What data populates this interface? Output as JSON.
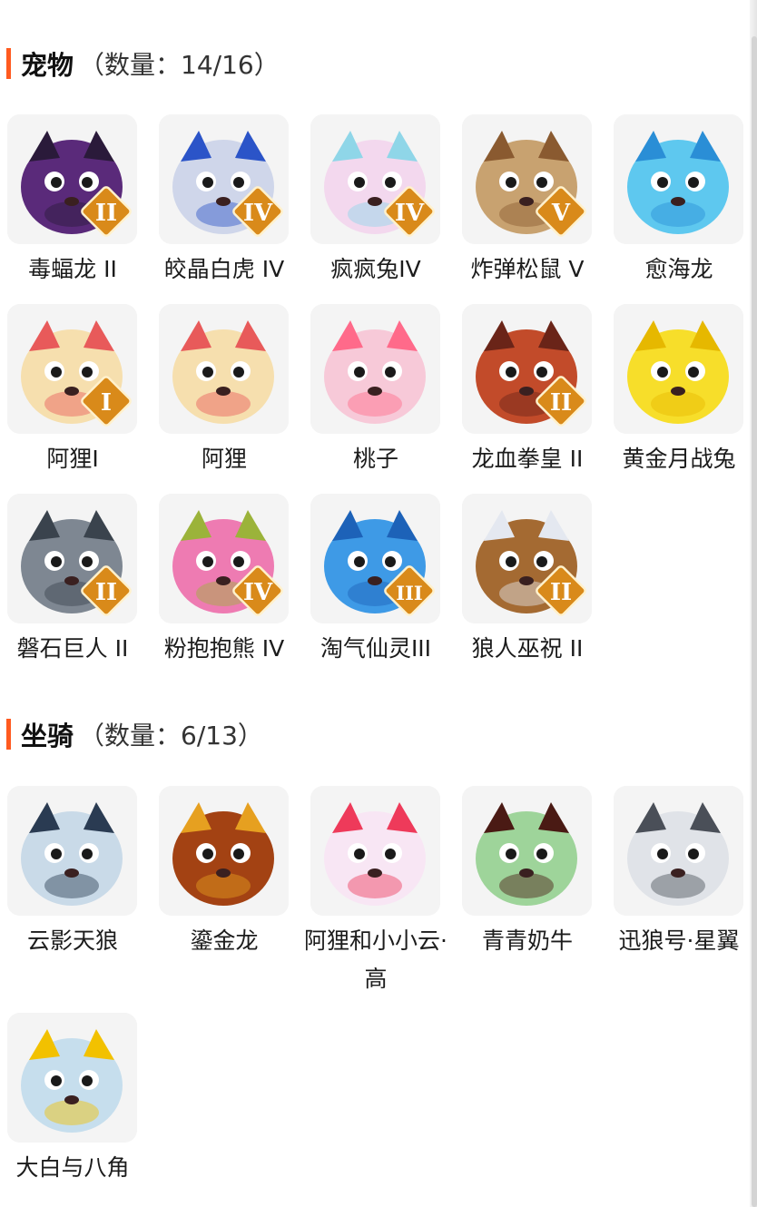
{
  "pets": {
    "title": "宠物",
    "count": "（数量：14/16）",
    "items": [
      {
        "label": "毒蝠龙 II",
        "icon": "dark-dragon-icon",
        "color": "#5a2a7a",
        "accent": "#2a1a3a",
        "rank": "II"
      },
      {
        "label": "皎晶白虎 IV",
        "icon": "white-tiger-icon",
        "color": "#cfd6ea",
        "accent": "#2b54c8",
        "rank": "IV"
      },
      {
        "label": "疯疯兔IV",
        "icon": "crazy-rabbit-icon",
        "color": "#f3d8ee",
        "accent": "#8fd6e8",
        "rank": "IV"
      },
      {
        "label": "炸弹松鼠 V",
        "icon": "bomb-squirrel-icon",
        "color": "#c8a270",
        "accent": "#8a5a30",
        "rank": "V"
      },
      {
        "label": "愈海龙",
        "icon": "sea-dragon-icon",
        "color": "#5ec8ef",
        "accent": "#2a8ed6",
        "rank": ""
      },
      {
        "label": "阿狸I",
        "icon": "ali-fox-icon",
        "color": "#f6dfae",
        "accent": "#e85a5a",
        "rank": "I"
      },
      {
        "label": "阿狸",
        "icon": "ali-fox-icon",
        "color": "#f6dfae",
        "accent": "#e85a5a",
        "rank": ""
      },
      {
        "label": "桃子",
        "icon": "peach-fox-icon",
        "color": "#f7c9d8",
        "accent": "#ff6a8a",
        "rank": ""
      },
      {
        "label": "龙血拳皇 II",
        "icon": "bull-demon-icon",
        "color": "#c24b2a",
        "accent": "#6a2418",
        "rank": "II"
      },
      {
        "label": "黄金月战兔",
        "icon": "golden-rabbit-icon",
        "color": "#f7de2a",
        "accent": "#e6b800",
        "rank": ""
      },
      {
        "label": "磐石巨人 II",
        "icon": "rock-giant-icon",
        "color": "#7e8792",
        "accent": "#3a434d",
        "rank": "II"
      },
      {
        "label": "粉抱抱熊 IV",
        "icon": "pink-bear-icon",
        "color": "#ee7bb2",
        "accent": "#9bb33a",
        "rank": "IV"
      },
      {
        "label": "淘气仙灵III",
        "icon": "blue-puppy-icon",
        "color": "#3e9ae6",
        "accent": "#1d62b8",
        "rank": "III"
      },
      {
        "label": "狼人巫祝 II",
        "icon": "werewolf-shaman-icon",
        "color": "#a46a32",
        "accent": "#e4e8f0",
        "rank": "II"
      }
    ]
  },
  "mounts": {
    "title": "坐骑",
    "count": "（数量：6/13）",
    "items": [
      {
        "label": "云影天狼",
        "icon": "sky-wolf-icon",
        "color": "#c9dae8",
        "accent": "#2a3b52",
        "rank": ""
      },
      {
        "label": "鎏金龙",
        "icon": "golden-dragon-icon",
        "color": "#a34213",
        "accent": "#e6a020",
        "rank": ""
      },
      {
        "label": "阿狸和小小云·高",
        "icon": "ali-cloud-icon",
        "color": "#f8e6f4",
        "accent": "#ee3a5a",
        "rank": ""
      },
      {
        "label": "青青奶牛",
        "icon": "green-cow-icon",
        "color": "#9ed49a",
        "accent": "#4a1a14",
        "rank": ""
      },
      {
        "label": "迅狼号·星翼",
        "icon": "mecha-wolf-icon",
        "color": "#e0e3e8",
        "accent": "#4a4f58",
        "rank": ""
      },
      {
        "label": "大白与八角",
        "icon": "white-whale-icon",
        "color": "#c6deed",
        "accent": "#f2c100",
        "rank": ""
      }
    ]
  }
}
